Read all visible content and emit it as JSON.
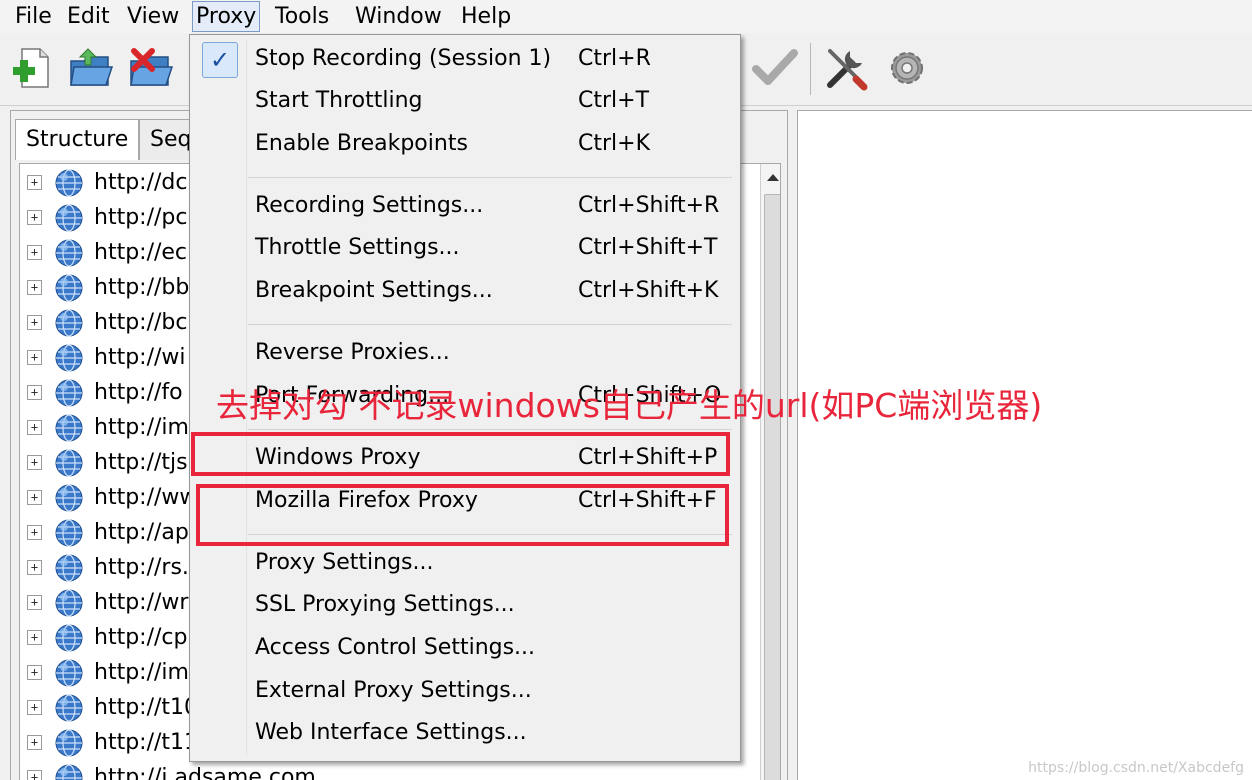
{
  "menubar": {
    "items": [
      {
        "label": "File"
      },
      {
        "label": "Edit"
      },
      {
        "label": "View"
      },
      {
        "label": "Proxy"
      },
      {
        "label": "Tools"
      },
      {
        "label": "Window"
      },
      {
        "label": "Help"
      }
    ]
  },
  "toolbar": {
    "icons": [
      "new-session-icon",
      "open-session-icon",
      "close-session-icon",
      "validate-check-icon",
      "tools-icon",
      "settings-gear-icon"
    ]
  },
  "tabs": [
    {
      "label": "Structure"
    },
    {
      "label": "Seq"
    }
  ],
  "tree": {
    "items": [
      {
        "host": "http://dc"
      },
      {
        "host": "http://pc"
      },
      {
        "host": "http://ec"
      },
      {
        "host": "http://bb"
      },
      {
        "host": "http://bc"
      },
      {
        "host": "http://wi"
      },
      {
        "host": "http://fo"
      },
      {
        "host": "http://im"
      },
      {
        "host": "http://tjs"
      },
      {
        "host": "http://ww"
      },
      {
        "host": "http://ap"
      },
      {
        "host": "http://rs."
      },
      {
        "host": "http://wr"
      },
      {
        "host": "http://cp"
      },
      {
        "host": "http://im"
      },
      {
        "host": "http://t10"
      },
      {
        "host": "http://t11"
      },
      {
        "host": "http://i.adsame.com"
      }
    ]
  },
  "proxy_menu": {
    "groups": [
      [
        {
          "label": "Stop Recording (Session 1)",
          "shortcut": "Ctrl+R",
          "checked": true
        },
        {
          "label": "Start Throttling",
          "shortcut": "Ctrl+T"
        },
        {
          "label": "Enable Breakpoints",
          "shortcut": "Ctrl+K"
        }
      ],
      [
        {
          "label": "Recording Settings...",
          "shortcut": "Ctrl+Shift+R"
        },
        {
          "label": "Throttle Settings...",
          "shortcut": "Ctrl+Shift+T"
        },
        {
          "label": "Breakpoint Settings...",
          "shortcut": "Ctrl+Shift+K"
        }
      ],
      [
        {
          "label": "Reverse Proxies...",
          "shortcut": ""
        },
        {
          "label": "Port Forwarding...",
          "shortcut": "Ctrl+Shift+O"
        }
      ],
      [
        {
          "label": "Windows Proxy",
          "shortcut": "Ctrl+Shift+P"
        },
        {
          "label": "Mozilla Firefox Proxy",
          "shortcut": "Ctrl+Shift+F"
        }
      ],
      [
        {
          "label": "Proxy Settings...",
          "shortcut": ""
        },
        {
          "label": "SSL Proxying Settings...",
          "shortcut": ""
        },
        {
          "label": "Access Control Settings...",
          "shortcut": ""
        },
        {
          "label": "External Proxy Settings...",
          "shortcut": ""
        },
        {
          "label": "Web Interface Settings...",
          "shortcut": ""
        }
      ]
    ],
    "check_mark": "✓"
  },
  "annotation": {
    "note": "去掉对勾 不记录windows自己产生的url(如PC端浏览器)",
    "color": "#e8253a"
  },
  "watermark": "https://blog.csdn.net/Xabcdefg"
}
